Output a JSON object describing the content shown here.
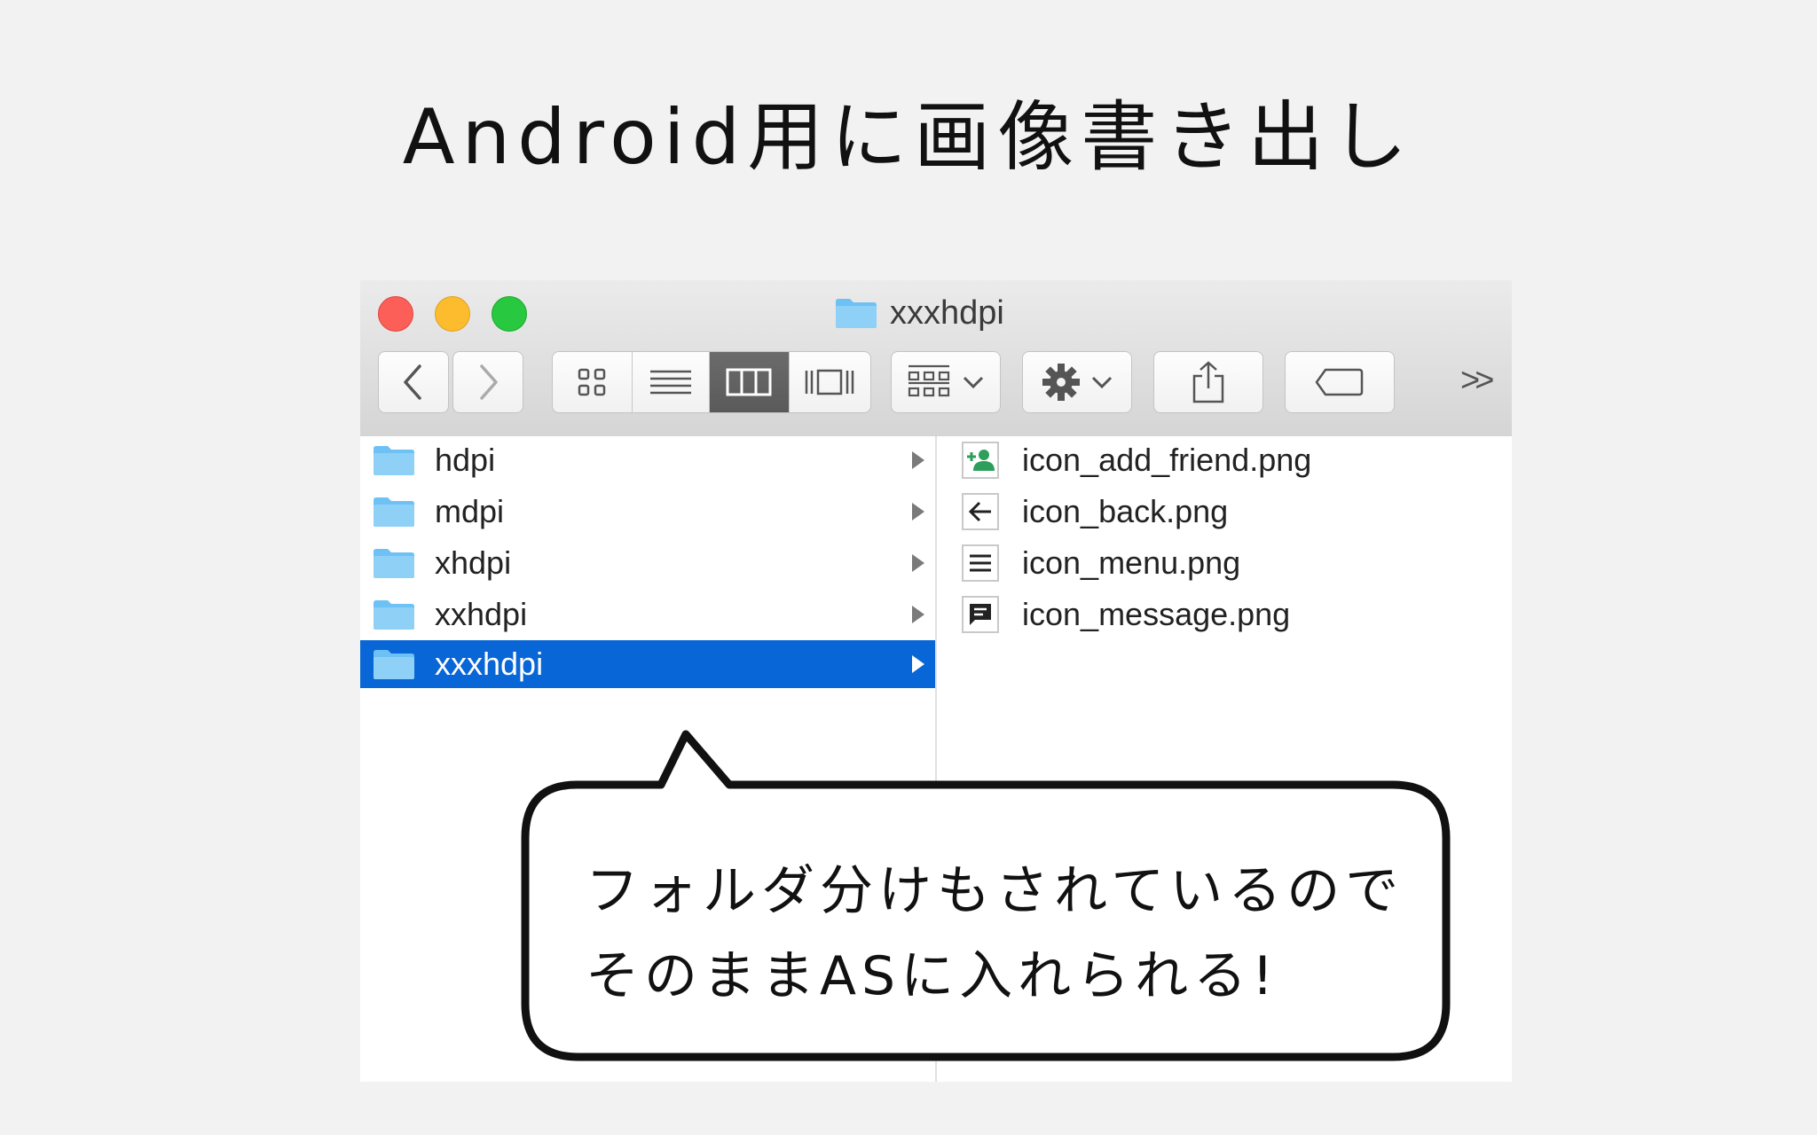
{
  "slide": {
    "title": "Android用に画像書き出し"
  },
  "window": {
    "title": "xxxhdpi",
    "toolbar": {
      "back_icon": "chevron-left-icon",
      "forward_icon": "chevron-right-icon",
      "view_modes": [
        "icon-view-icon",
        "list-view-icon",
        "column-view-icon",
        "cover-flow-icon"
      ],
      "active_view": "column-view-icon",
      "arrange_icon": "arrange-grid-icon",
      "action_icon": "gear-icon",
      "share_icon": "share-icon",
      "tag_icon": "tag-icon",
      "overflow_label": ">>"
    }
  },
  "column1": {
    "folders": [
      {
        "label": "hdpi",
        "selected": false
      },
      {
        "label": "mdpi",
        "selected": false
      },
      {
        "label": "xhdpi",
        "selected": false
      },
      {
        "label": "xxhdpi",
        "selected": false
      },
      {
        "label": "xxxhdpi",
        "selected": true
      }
    ]
  },
  "column2": {
    "files": [
      {
        "label": "icon_add_friend.png",
        "icon": "add-friend-icon"
      },
      {
        "label": "icon_back.png",
        "icon": "back-arrow-icon"
      },
      {
        "label": "icon_menu.png",
        "icon": "menu-icon"
      },
      {
        "label": "icon_message.png",
        "icon": "message-icon"
      }
    ]
  },
  "callout": {
    "line1": "フォルダ分けもされているので",
    "line2": "そのままASに入れられる!"
  },
  "colors": {
    "selection": "#0866d6",
    "folder": "#6ec1f5",
    "close": "#fc5f57",
    "minimize": "#fdbc2e",
    "zoom": "#28c840"
  }
}
